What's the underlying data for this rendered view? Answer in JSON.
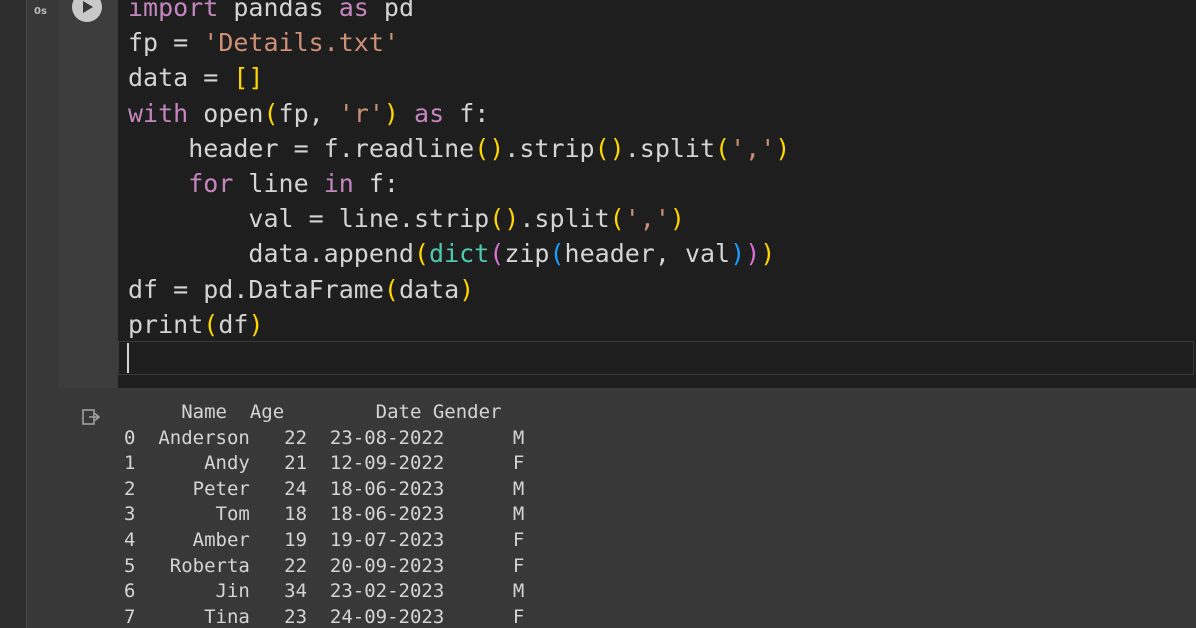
{
  "cell": {
    "execution_count": "0s",
    "code_lines": [
      [
        {
          "t": "import",
          "c": "kw"
        },
        {
          "t": " pandas "
        },
        {
          "t": "as",
          "c": "kw"
        },
        {
          "t": " pd"
        }
      ],
      [
        {
          "t": "fp = "
        },
        {
          "t": "'Details.txt'",
          "c": "st"
        }
      ],
      [
        {
          "t": "data = "
        },
        {
          "t": "[]",
          "c": "p1"
        }
      ],
      [
        {
          "t": "with",
          "c": "kw"
        },
        {
          "t": " open"
        },
        {
          "t": "(",
          "c": "p1"
        },
        {
          "t": "fp, "
        },
        {
          "t": "'r'",
          "c": "st"
        },
        {
          "t": ")",
          "c": "p1"
        },
        {
          "t": " "
        },
        {
          "t": "as",
          "c": "kw"
        },
        {
          "t": " f:"
        }
      ],
      [
        {
          "t": "    header = f.readline"
        },
        {
          "t": "()",
          "c": "p1"
        },
        {
          "t": ".strip"
        },
        {
          "t": "()",
          "c": "p1"
        },
        {
          "t": ".split"
        },
        {
          "t": "(",
          "c": "p1"
        },
        {
          "t": "','",
          "c": "st"
        },
        {
          "t": ")",
          "c": "p1"
        }
      ],
      [
        {
          "t": "    "
        },
        {
          "t": "for",
          "c": "kw"
        },
        {
          "t": " line "
        },
        {
          "t": "in",
          "c": "kw"
        },
        {
          "t": " f:"
        }
      ],
      [
        {
          "t": "        val = line.strip"
        },
        {
          "t": "()",
          "c": "p1"
        },
        {
          "t": ".split"
        },
        {
          "t": "(",
          "c": "p1"
        },
        {
          "t": "','",
          "c": "st"
        },
        {
          "t": ")",
          "c": "p1"
        }
      ],
      [
        {
          "t": "        data.append"
        },
        {
          "t": "(",
          "c": "p1"
        },
        {
          "t": "dict",
          "c": "bi"
        },
        {
          "t": "(",
          "c": "p2"
        },
        {
          "t": "zip"
        },
        {
          "t": "(",
          "c": "p3"
        },
        {
          "t": "header, val"
        },
        {
          "t": ")",
          "c": "p3"
        },
        {
          "t": ")",
          "c": "p2"
        },
        {
          "t": ")",
          "c": "p1"
        }
      ],
      [
        {
          "t": "df = pd.DataFrame"
        },
        {
          "t": "(",
          "c": "p1"
        },
        {
          "t": "data"
        },
        {
          "t": ")",
          "c": "p1"
        }
      ],
      [
        {
          "t": "print"
        },
        {
          "t": "(",
          "c": "p1"
        },
        {
          "t": "df"
        },
        {
          "t": ")",
          "c": "p1"
        }
      ]
    ]
  },
  "output": {
    "header": "     Name  Age        Date Gender",
    "rows": [
      "0  Anderson   22  23-08-2022      M",
      "1      Andy   21  12-09-2022      F",
      "2     Peter   24  18-06-2023      M",
      "3       Tom   18  18-06-2023      M",
      "4     Amber   19  19-07-2023      F",
      "5   Roberta   22  20-09-2023      F",
      "6       Jin   34  23-02-2023      M",
      "7      Tina   23  24-09-2023      F"
    ]
  },
  "icons": {
    "run": "play-circle-icon",
    "output": "output-arrow-icon"
  }
}
